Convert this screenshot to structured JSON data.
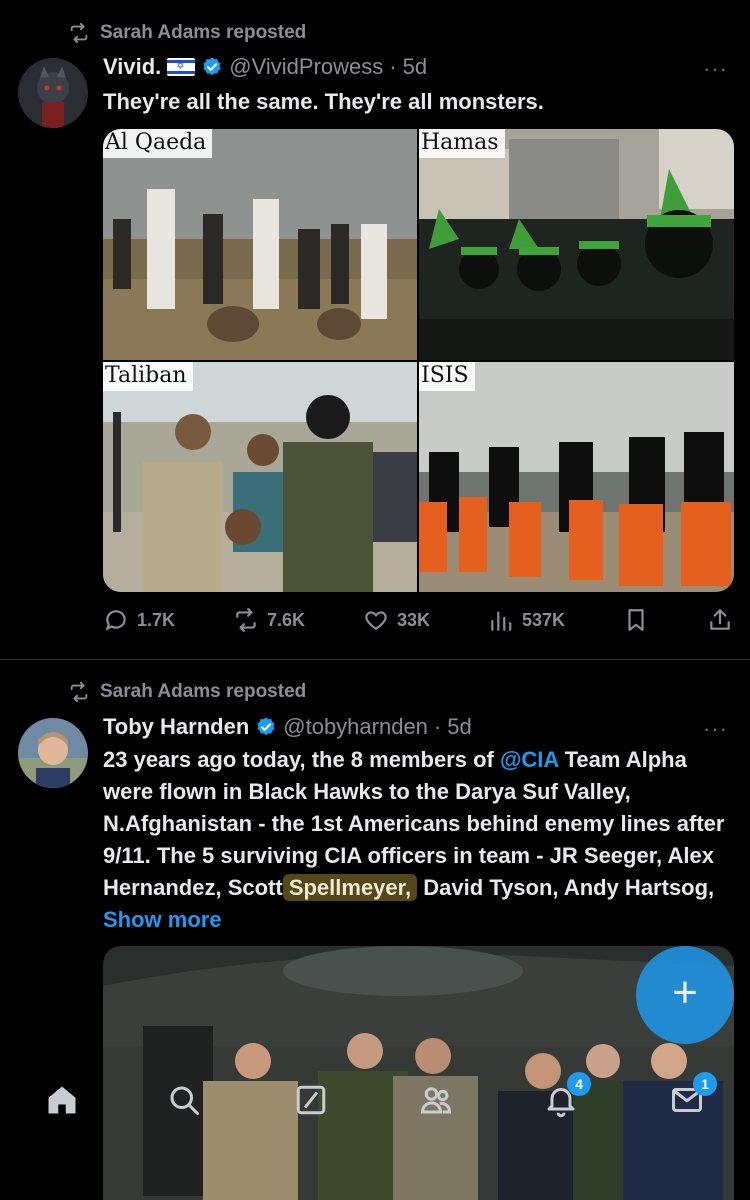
{
  "tweets": [
    {
      "repost_text": "Sarah Adams reposted",
      "author_name": "Vivid.",
      "handle": "@VividProwess",
      "time": "5d",
      "text": "They're all the same. They're all monsters.",
      "media_labels": [
        "Al Qaeda",
        "Hamas",
        "Taliban",
        "ISIS"
      ],
      "stats": {
        "replies": "1.7K",
        "reposts": "7.6K",
        "likes": "33K",
        "views": "537K"
      }
    },
    {
      "repost_text": "Sarah Adams reposted",
      "author_name": "Toby Harnden",
      "handle": "@tobyharnden",
      "time": "5d",
      "text_part1": "23 years ago today, the 8 members of ",
      "mention": "@CIA",
      "text_part2": " Team Alpha were flown in Black Hawks to the Darya Suf Valley, N.Afghanistan - the 1st Americans behind enemy lines after 9/11. The 5 surviving CIA officers in team - JR Seeger, Alex Hernandez, Scott ",
      "highlighted": "Spellmeyer,",
      "text_part3": " David Tyson, Andy Hartsog, ",
      "show_more": "Show more"
    }
  ],
  "separator": "·",
  "more_menu": "···",
  "fab_label": "+",
  "nav": {
    "notifications_badge": "4",
    "messages_badge": "1"
  },
  "colors": {
    "background": "#000000",
    "accent": "#1d9bf0",
    "muted": "#8b8f94",
    "highlight": "#54471a"
  }
}
